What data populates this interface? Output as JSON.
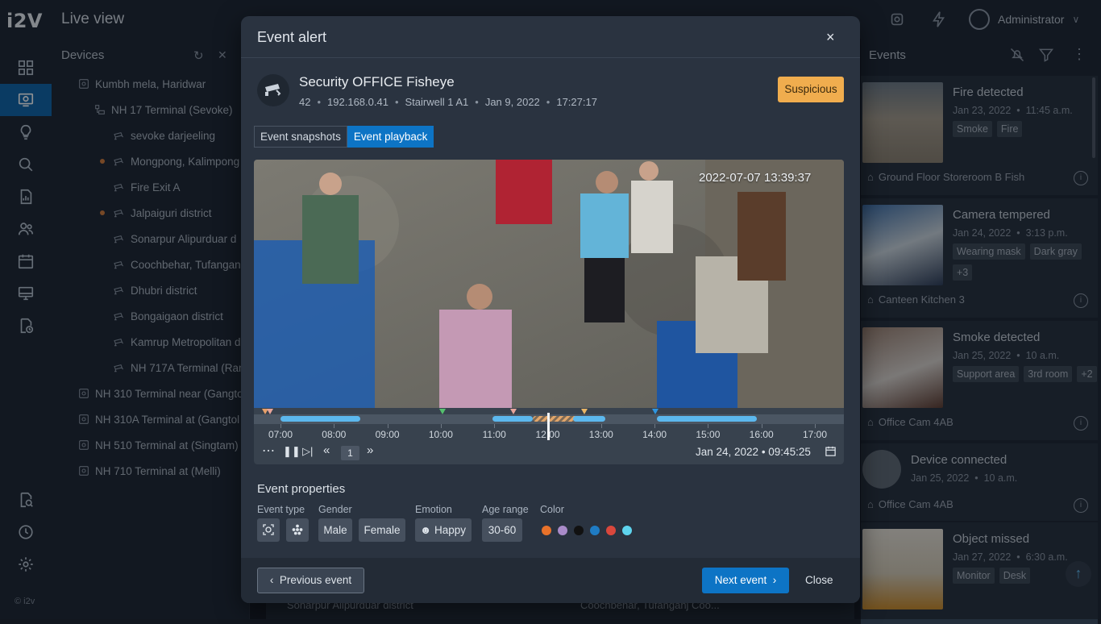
{
  "app": {
    "logo": "i2V",
    "copyright": "© i2v"
  },
  "header": {
    "title": "Live view",
    "user": "Administrator"
  },
  "devices": {
    "title": "Devices",
    "items": [
      {
        "label": "Kumbh mela, Haridwar"
      },
      {
        "label": "NH 17 Terminal (Sevoke)"
      },
      {
        "label": "sevoke darjeeling"
      },
      {
        "label": "Mongpong, Kalimpong"
      },
      {
        "label": "Fire Exit A"
      },
      {
        "label": "Jalpaiguri district"
      },
      {
        "label": "Sonarpur Alipurduar d"
      },
      {
        "label": "Coochbehar, Tufangan"
      },
      {
        "label": "Dhubri district"
      },
      {
        "label": "Bongaigaon district"
      },
      {
        "label": "Kamrup Metropolitan d"
      },
      {
        "label": "NH 717A Terminal (Ran"
      },
      {
        "label": "NH 310 Terminal near (Gangto"
      },
      {
        "label": "NH 310A Terminal at (Gangtol"
      },
      {
        "label": "NH 510 Terminal at (Singtam)"
      },
      {
        "label": "NH 710 Terminal at (Melli)"
      }
    ]
  },
  "events_panel": {
    "title": "Events",
    "cards": [
      {
        "title": "Fire detected",
        "date": "Jan 23, 2022",
        "time": "11:45 a.m.",
        "tags": [
          "Smoke",
          "Fire"
        ],
        "location": "Ground Floor Storeroom B Fish"
      },
      {
        "title": "Camera tempered",
        "date": "Jan 24, 2022",
        "time": "3:13 p.m.",
        "tags": [
          "Wearing mask",
          "Dark gray",
          "+3"
        ],
        "location": "Canteen Kitchen 3"
      },
      {
        "title": "Smoke detected",
        "date": "Jan 25, 2022",
        "time": "10 a.m.",
        "tags": [
          "Support area",
          "3rd room",
          "+2"
        ],
        "location": "Office Cam 4AB"
      },
      {
        "title": "Device connected",
        "date": "Jan 25, 2022",
        "time": "10 a.m.",
        "tags": [],
        "location": "Office Cam 4AB"
      },
      {
        "title": "Object missed",
        "date": "Jan 27, 2022",
        "time": "6:30 a.m.",
        "tags": [
          "Monitor",
          "Desk"
        ],
        "location": ""
      }
    ]
  },
  "bottom_strip": {
    "left": "Sonarpur Alipurduar district",
    "right": "Coochbehar, Tufanganj Coo..."
  },
  "modal": {
    "title": "Event alert",
    "close_icon": "×",
    "camera_name": "Security OFFICE Fisheye",
    "camera_id": "42",
    "ip": "192.168.0.41",
    "location": "Stairwell 1 A1",
    "date": "Jan 9, 2022",
    "time": "17:27:17",
    "badge": "Suspicious",
    "badge_color": "#f0ad4e",
    "tabs": {
      "snapshots": "Event snapshots",
      "playback": "Event playback"
    },
    "video_timestamp": "2022-07-07 13:39:37",
    "timeline": {
      "labels": [
        "07:00",
        "08:00",
        "09:00",
        "10:00",
        "11:00",
        "12:00",
        "13:00",
        "14:00",
        "15:00",
        "16:00",
        "17:00"
      ],
      "speed": "1",
      "datetime": "Jan 24, 2022 • 09:45:25"
    },
    "properties": {
      "title": "Event properties",
      "event_type_label": "Event type",
      "gender_label": "Gender",
      "gender_values": [
        "Male",
        "Female"
      ],
      "emotion_label": "Emotion",
      "emotion_value": "Happy",
      "age_label": "Age range",
      "age_value": "30-60",
      "color_label": "Color",
      "colors": [
        "#e8722a",
        "#a98bc9",
        "#111111",
        "#1f7cc4",
        "#d9473c",
        "#5ed4ee"
      ]
    },
    "footer": {
      "previous": "Previous event",
      "next": "Next event",
      "close": "Close"
    }
  }
}
